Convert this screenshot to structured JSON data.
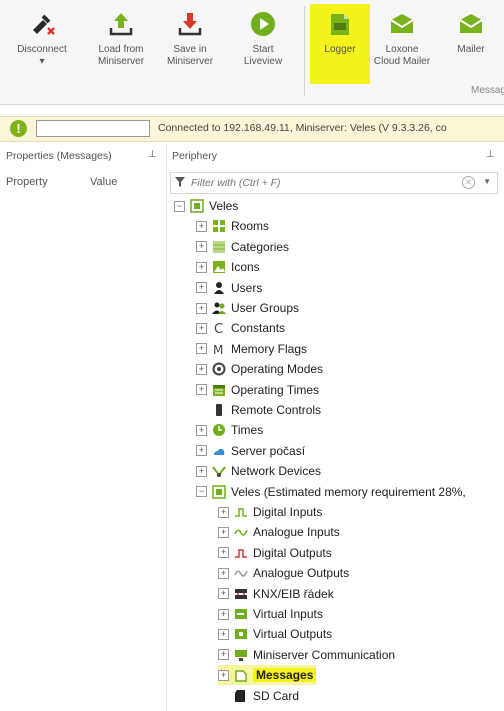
{
  "ribbon": {
    "buttons": [
      {
        "label": "Disconnect\n▾",
        "icon": "disconnect-icon"
      },
      {
        "label": "Load from\nMiniserver",
        "icon": "upload-icon"
      },
      {
        "label": "Save in\nMiniserver",
        "icon": "download-icon"
      },
      {
        "label": "Start\nLiveview",
        "icon": "play-icon"
      },
      {
        "label": "Logger",
        "icon": "logger-icon"
      },
      {
        "label": "Loxone\nCloud Mailer",
        "icon": "cloud-mail-icon"
      },
      {
        "label": "Mailer",
        "icon": "mail-icon"
      }
    ],
    "group_label": "Messag"
  },
  "status": {
    "input_value": "",
    "text": "Connected to 192.168.49.11, Miniserver: Veles (V 9.3.3.26, co"
  },
  "properties_panel": {
    "title": "Properties (Messages)",
    "pin": "⊥",
    "col_property": "Property",
    "col_value": "Value"
  },
  "periphery_panel": {
    "title": "Periphery",
    "pin": "⊥",
    "filter_placeholder": "Filter with (Ctrl + F)"
  },
  "tree": [
    {
      "label": "Veles",
      "level": 0,
      "exp": "−",
      "icon": "miniserver-icon"
    },
    {
      "label": "Rooms",
      "level": 1,
      "exp": "+",
      "icon": "rooms-icon"
    },
    {
      "label": "Categories",
      "level": 1,
      "exp": "+",
      "icon": "categories-icon"
    },
    {
      "label": "Icons",
      "level": 1,
      "exp": "+",
      "icon": "icons-icon"
    },
    {
      "label": "Users",
      "level": 1,
      "exp": "+",
      "icon": "user-icon"
    },
    {
      "label": "User Groups",
      "level": 1,
      "exp": "+",
      "icon": "user-groups-icon"
    },
    {
      "label": "Constants",
      "level": 1,
      "exp": "+",
      "icon": "constants-icon"
    },
    {
      "label": "Memory Flags",
      "level": 1,
      "exp": "+",
      "icon": "memory-flags-icon"
    },
    {
      "label": "Operating Modes",
      "level": 1,
      "exp": "+",
      "icon": "operating-modes-icon"
    },
    {
      "label": "Operating Times",
      "level": 1,
      "exp": "+",
      "icon": "calendar-icon"
    },
    {
      "label": "Remote Controls",
      "level": 1,
      "exp": "",
      "icon": "remote-icon"
    },
    {
      "label": "Times",
      "level": 1,
      "exp": "+",
      "icon": "clock-icon"
    },
    {
      "label": "Server počasí",
      "level": 1,
      "exp": "+",
      "icon": "weather-icon"
    },
    {
      "label": "Network Devices",
      "level": 1,
      "exp": "+",
      "icon": "network-icon"
    },
    {
      "label": "Veles (Estimated memory requirement 28%,",
      "level": 1,
      "exp": "−",
      "icon": "miniserver-icon"
    },
    {
      "label": "Digital Inputs",
      "level": 2,
      "exp": "+",
      "icon": "digital-inputs-icon"
    },
    {
      "label": "Analogue Inputs",
      "level": 2,
      "exp": "+",
      "icon": "analogue-inputs-icon"
    },
    {
      "label": "Digital Outputs",
      "level": 2,
      "exp": "+",
      "icon": "digital-outputs-icon"
    },
    {
      "label": "Analogue Outputs",
      "level": 2,
      "exp": "+",
      "icon": "analogue-outputs-icon"
    },
    {
      "label": "KNX/EIB řádek",
      "level": 2,
      "exp": "+",
      "icon": "knx-icon"
    },
    {
      "label": "Virtual Inputs",
      "level": 2,
      "exp": "+",
      "icon": "virtual-inputs-icon"
    },
    {
      "label": "Virtual Outputs",
      "level": 2,
      "exp": "+",
      "icon": "virtual-outputs-icon"
    },
    {
      "label": "Miniserver Communication",
      "level": 2,
      "exp": "+",
      "icon": "communication-icon"
    },
    {
      "label": "Messages",
      "level": 2,
      "exp": "+",
      "icon": "messages-icon",
      "selected": true
    },
    {
      "label": "SD Card",
      "level": 2,
      "exp": "",
      "icon": "sd-card-icon"
    }
  ],
  "colors": {
    "accent_green": "#80b318",
    "highlight": "#f3f21a",
    "warn_bg": "#fbf6d8"
  }
}
